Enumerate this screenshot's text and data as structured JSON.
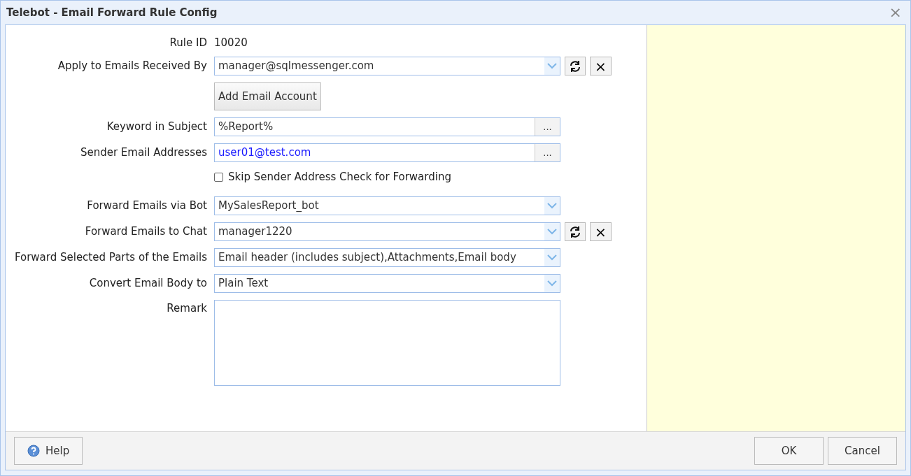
{
  "window": {
    "title": "Telebot - Email Forward Rule Config",
    "close": "×"
  },
  "rows": [
    {
      "kind": "text",
      "label": "Rule ID",
      "value": "10020"
    },
    {
      "kind": "dropdown",
      "label": "Apply to Emails Received By",
      "value": "manager@sqlmessenger.com",
      "refresh": true,
      "clear": "×"
    },
    {
      "kind": "button",
      "label": "Add Email Account"
    },
    {
      "kind": "browse",
      "label": "Keyword in Subject",
      "value": "%Report%",
      "button": "...",
      "link": false
    },
    {
      "kind": "browse",
      "label": "Sender Email Addresses",
      "value": "user01@test.com",
      "button": "...",
      "link": true
    },
    {
      "kind": "checkbox",
      "label": "Skip Sender Address Check for Forwarding",
      "checked": false
    },
    {
      "kind": "dropdown",
      "label": "Forward Emails via Bot",
      "value": "MySalesReport_bot",
      "refresh": false
    },
    {
      "kind": "dropdown",
      "label": "Forward Emails to Chat",
      "value": "manager1220",
      "refresh": true,
      "clear": "×"
    },
    {
      "kind": "dropdown",
      "label": "Forward Selected Parts of the Emails",
      "value": "Email header (includes subject),Attachments,Email body",
      "refresh": false
    },
    {
      "kind": "dropdown",
      "label": "Convert Email Body to",
      "value": "Plain Text",
      "refresh": false
    },
    {
      "kind": "textarea",
      "label": "Remark",
      "value": ""
    }
  ],
  "footer": {
    "help": "Help",
    "ok": "OK",
    "cancel": "Cancel"
  }
}
